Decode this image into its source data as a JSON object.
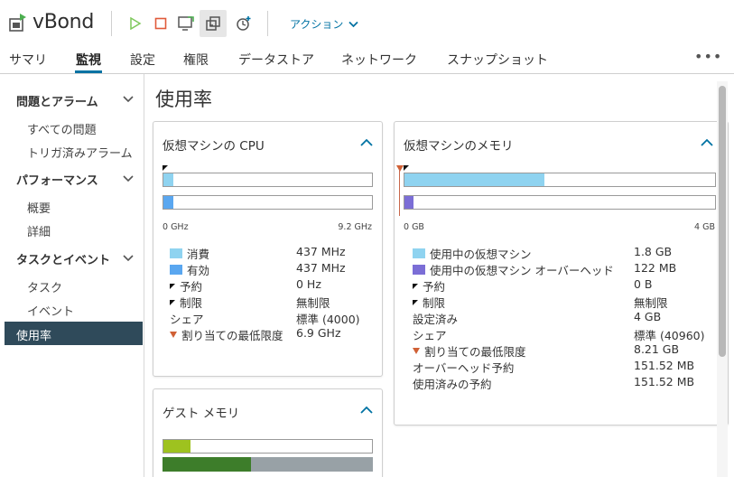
{
  "header": {
    "vm_name": "vBond",
    "actions_label": "アクション"
  },
  "tabs": [
    "サマリ",
    "監視",
    "設定",
    "権限",
    "データストア",
    "ネットワーク",
    "スナップショット"
  ],
  "more": "•••",
  "sidebar": {
    "sections": [
      {
        "title": "問題とアラーム",
        "items": [
          "すべての問題",
          "トリガ済みアラーム"
        ]
      },
      {
        "title": "パフォーマンス",
        "items": [
          "概要",
          "詳細"
        ]
      },
      {
        "title": "タスクとイベント",
        "items": [
          "タスク",
          "イベント"
        ]
      },
      {
        "title": "",
        "items": [
          "使用率"
        ]
      }
    ],
    "active_item": "使用率"
  },
  "page_title": "使用率",
  "cpu_card": {
    "title": "仮想マシンの CPU",
    "scale_min": "0 GHz",
    "scale_max": "9.2 GHz",
    "bar_consumed_fraction": 0.047,
    "bar_active_fraction": 0.047,
    "rows": [
      {
        "label": "消費",
        "value": "437 MHz",
        "marker": "swatch",
        "color": "#8fd3f0"
      },
      {
        "label": "有効",
        "value": "437 MHz",
        "marker": "swatch",
        "color": "#5aa7f0"
      },
      {
        "label": "予約",
        "value": "0 Hz",
        "marker": "black-triangle"
      },
      {
        "label": "制限",
        "value": "無制限",
        "marker": "black-triangle"
      },
      {
        "label": "シェア",
        "value": "標準 (4000)",
        "marker": "none"
      },
      {
        "label": "割り当ての最低限度",
        "value": "6.9 GHz",
        "marker": "red-triangle"
      }
    ]
  },
  "mem_card": {
    "title": "仮想マシンのメモリ",
    "scale_min": "0 GB",
    "scale_max": "4 GB",
    "bar_guest_fraction": 0.45,
    "bar_overhead_fraction": 0.03,
    "rows": [
      {
        "label": "使用中の仮想マシン",
        "value": "1.8 GB",
        "marker": "swatch",
        "color": "#8fd3f0"
      },
      {
        "label": "使用中の仮想マシン オーバーヘッド",
        "value": "122 MB",
        "marker": "swatch",
        "color": "#7b6ed6"
      },
      {
        "label": "予約",
        "value": "0 B",
        "marker": "black-triangle"
      },
      {
        "label": "制限",
        "value": "無制限",
        "marker": "black-triangle"
      },
      {
        "label": "設定済み",
        "value": "4 GB",
        "marker": "none"
      },
      {
        "label": "シェア",
        "value": "標準 (40960)",
        "marker": "none"
      },
      {
        "label": "割り当ての最低限度",
        "value": "8.21 GB",
        "marker": "red-triangle"
      },
      {
        "label": "オーバーヘッド予約",
        "value": "151.52 MB",
        "marker": "none"
      },
      {
        "label": "使用済みの予約",
        "value": "151.52 MB",
        "marker": "none"
      }
    ]
  },
  "guest_card": {
    "title": "ゲスト メモリ",
    "bar1_fraction": 0.13,
    "bar2_fraction": 0.42
  },
  "colors": {
    "accent": "#0072a3",
    "active_nav": "#2f4a5a",
    "cpu_consumed": "#8fd3f0",
    "cpu_active": "#5aa7f0",
    "mem_guest": "#8fd3f0",
    "mem_overhead": "#7b6ed6",
    "guest_bar1": "#9ec21f",
    "guest_bar2_used": "#3d7d2a",
    "guest_bar2_rest": "#98a1a6"
  }
}
